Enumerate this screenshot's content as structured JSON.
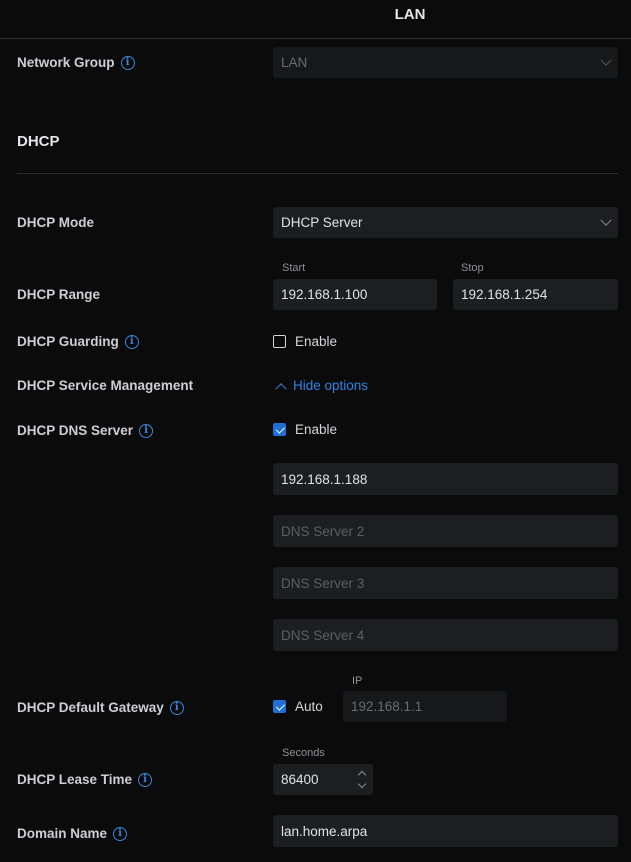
{
  "header": {
    "title": "LAN"
  },
  "network_group": {
    "label": "Network Group",
    "value": "LAN"
  },
  "dhcp_section": {
    "title": "DHCP"
  },
  "dhcp_mode": {
    "label": "DHCP Mode",
    "value": "DHCP Server"
  },
  "dhcp_range": {
    "label": "DHCP Range",
    "start_label": "Start",
    "start_value": "192.168.1.100",
    "stop_label": "Stop",
    "stop_value": "192.168.1.254"
  },
  "dhcp_guarding": {
    "label": "DHCP Guarding",
    "checkbox_label": "Enable",
    "checked": false
  },
  "dhcp_service_mgmt": {
    "label": "DHCP Service Management",
    "toggle_label": "Hide options"
  },
  "dhcp_dns_server": {
    "label": "DHCP DNS Server",
    "checkbox_label": "Enable",
    "checked": true,
    "server1_value": "192.168.1.188",
    "server2_placeholder": "DNS Server 2",
    "server3_placeholder": "DNS Server 3",
    "server4_placeholder": "DNS Server 4"
  },
  "dhcp_default_gateway": {
    "label": "DHCP Default Gateway",
    "checkbox_label": "Auto",
    "checked": true,
    "ip_label": "IP",
    "ip_value": "192.168.1.1"
  },
  "dhcp_lease_time": {
    "label": "DHCP Lease Time",
    "unit_label": "Seconds",
    "value": "86400"
  },
  "domain_name": {
    "label": "Domain Name",
    "value": "lan.home.arpa"
  },
  "colors": {
    "background": "#0b0b0c",
    "accent": "#2f82e6",
    "field": "#1d1e21"
  }
}
